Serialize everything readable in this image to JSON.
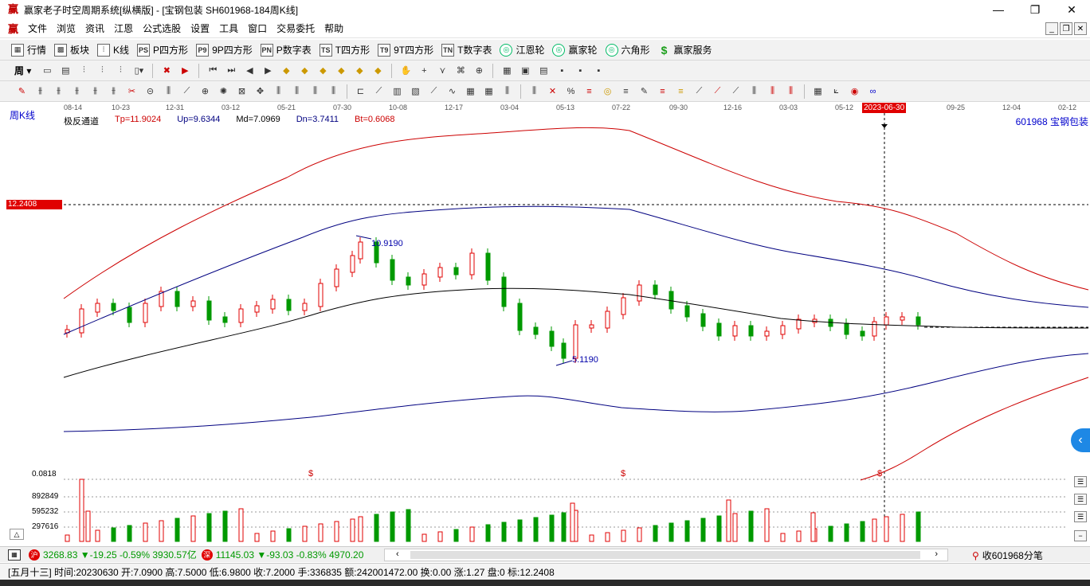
{
  "window": {
    "title": "赢家老子时空周期系统[纵横版] - [宝钢包装  SH601968-184周K线]",
    "logo_text": "赢",
    "controls": {
      "minimize": "—",
      "maximize": "❐",
      "close": "✕"
    }
  },
  "menu": {
    "items": [
      "文件",
      "浏览",
      "资讯",
      "江恩",
      "公式选股",
      "设置",
      "工具",
      "窗口",
      "交易委托",
      "帮助"
    ]
  },
  "toolbar1": {
    "items": [
      {
        "icon": "▦",
        "label": "行情"
      },
      {
        "icon": "▩",
        "label": "板块"
      },
      {
        "icon": "⫶",
        "label": "K线"
      },
      {
        "icon": "PS",
        "label": "P四方形"
      },
      {
        "icon": "P9",
        "label": "9P四方形"
      },
      {
        "icon": "PN",
        "label": "P数字表"
      },
      {
        "icon": "TS",
        "label": "T四方形"
      },
      {
        "icon": "T9",
        "label": "9T四方形"
      },
      {
        "icon": "TN",
        "label": "T数字表"
      },
      {
        "icon": "◎",
        "label": "江恩轮"
      },
      {
        "icon": "◎",
        "label": "赢家轮"
      },
      {
        "icon": "◎",
        "label": "六角形"
      },
      {
        "icon": "$",
        "label": "赢家服务"
      }
    ]
  },
  "toolbar2": {
    "period_label": "周"
  },
  "chart": {
    "period_label": "周K线",
    "stock": "601968 宝钢包装",
    "indicator": {
      "name": "极反通道",
      "tp": "Tp=11.9024",
      "up": "Up=9.6344",
      "md": "Md=7.0969",
      "dn": "Dn=3.7411",
      "bt": "Bt=0.6068"
    },
    "price_tag": "12.2408",
    "high_annotation": "10.9190",
    "low_annotation": "5.1190",
    "date_labels": [
      "08-14",
      "10-23",
      "12-31",
      "03-12",
      "05-21",
      "07-30",
      "10-08",
      "12-17",
      "03-04",
      "05-13",
      "07-22",
      "09-30",
      "12-16",
      "03-03",
      "05-12",
      "09-25",
      "12-04",
      "02-12"
    ],
    "highlight_date": "2023-06-30",
    "volume_labels": [
      "0.0818",
      "892849",
      "595232",
      "297616"
    ],
    "dollar_mark": "$",
    "colors": {
      "up": "#e00000",
      "down": "#009900",
      "ma": "#000000",
      "channel_outer": "#cc0000",
      "channel_inner": "#000080"
    }
  },
  "ticker": {
    "sh": {
      "value": "3268.83",
      "change": "▼-19.25",
      "pct": "-0.59%",
      "amount": "3930.57亿"
    },
    "sz": {
      "value": "11145.03",
      "change": "▼-93.03",
      "pct": "-0.83%",
      "amount": "4970.20"
    },
    "sh_icon": "沪",
    "sz_icon": "深",
    "right_label": "收601968分笔"
  },
  "status": {
    "text": "[五月十三] 时间:20230630 开:7.0900 高:7.5000 低:6.9800 收:7.2000 手:336835 额:242001472.00 换:0.00 涨:1.27 盘:0 标:12.2408"
  }
}
